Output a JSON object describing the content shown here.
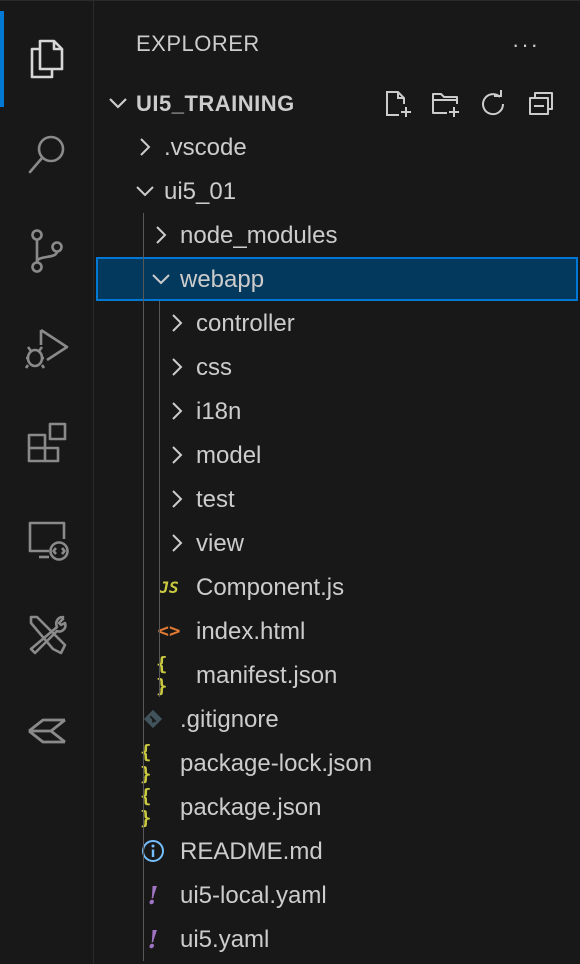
{
  "activity_bar": {
    "items": [
      {
        "name": "explorer",
        "icon": "files-icon",
        "active": true
      },
      {
        "name": "search",
        "icon": "search-icon"
      },
      {
        "name": "source-control",
        "icon": "source-control-icon"
      },
      {
        "name": "run-debug",
        "icon": "run-debug-icon"
      },
      {
        "name": "extensions",
        "icon": "extensions-icon"
      },
      {
        "name": "remote-explorer",
        "icon": "remote-explorer-icon"
      },
      {
        "name": "sap-tools",
        "icon": "tools-icon"
      },
      {
        "name": "sap-fiori",
        "icon": "fiori-icon"
      }
    ]
  },
  "sidebar": {
    "title": "EXPLORER",
    "more": "···",
    "workspace": {
      "name": "UI5_TRAINING",
      "actions": [
        "new-file-icon",
        "new-folder-icon",
        "refresh-icon",
        "collapse-all-icon"
      ]
    },
    "tree": [
      {
        "label": ".vscode",
        "type": "folder",
        "expanded": false,
        "depth": 0
      },
      {
        "label": "ui5_01",
        "type": "folder",
        "expanded": true,
        "depth": 0
      },
      {
        "label": "node_modules",
        "type": "folder",
        "expanded": false,
        "depth": 1
      },
      {
        "label": "webapp",
        "type": "folder",
        "expanded": true,
        "depth": 1,
        "selected": true
      },
      {
        "label": "controller",
        "type": "folder",
        "expanded": false,
        "depth": 2
      },
      {
        "label": "css",
        "type": "folder",
        "expanded": false,
        "depth": 2
      },
      {
        "label": "i18n",
        "type": "folder",
        "expanded": false,
        "depth": 2
      },
      {
        "label": "model",
        "type": "folder",
        "expanded": false,
        "depth": 2
      },
      {
        "label": "test",
        "type": "folder",
        "expanded": false,
        "depth": 2
      },
      {
        "label": "view",
        "type": "folder",
        "expanded": false,
        "depth": 2
      },
      {
        "label": "Component.js",
        "type": "file",
        "icon": "js-icon",
        "depth": 2
      },
      {
        "label": "index.html",
        "type": "file",
        "icon": "html-icon",
        "depth": 2
      },
      {
        "label": "manifest.json",
        "type": "file",
        "icon": "json-icon",
        "depth": 2
      },
      {
        "label": ".gitignore",
        "type": "file",
        "icon": "git-icon",
        "depth": 1
      },
      {
        "label": "package-lock.json",
        "type": "file",
        "icon": "json-icon",
        "depth": 1
      },
      {
        "label": "package.json",
        "type": "file",
        "icon": "json-icon",
        "depth": 1
      },
      {
        "label": "README.md",
        "type": "file",
        "icon": "info-icon",
        "depth": 1
      },
      {
        "label": "ui5-local.yaml",
        "type": "file",
        "icon": "yaml-icon",
        "depth": 1
      },
      {
        "label": "ui5.yaml",
        "type": "file",
        "icon": "yaml-icon",
        "depth": 1
      }
    ]
  },
  "glyphs": {
    "js": "JS",
    "html": "<>",
    "json": "{ }",
    "yaml": "!"
  },
  "colors": {
    "background": "#181818",
    "accent": "#0078d4",
    "selection": "#04395e",
    "js": "#cbcb41",
    "json": "#cbcb41",
    "html": "#e37933",
    "yaml": "#a074c4",
    "info": "#75beff"
  }
}
